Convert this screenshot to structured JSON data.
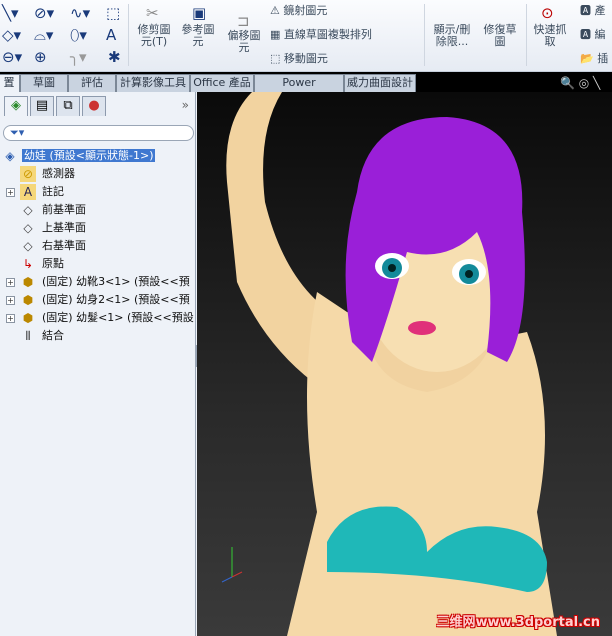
{
  "toolbar": {
    "trim": "修剪圖元(T)",
    "convert": "參考圖元",
    "offset": "偏移圖元",
    "mirror": "鏡射圖元",
    "linear_pattern": "直線草圖複製排列",
    "move": "移動圖元",
    "display_delete": "顯示/刪除限...",
    "repair": "修復草圖",
    "quick_snap": "快速抓取",
    "right1": "產",
    "right2": "編",
    "right3": "插"
  },
  "tabs": [
    "置",
    "草圖",
    "評估",
    "計算影像工具",
    "Office 產品",
    "Power Surfacing",
    "威力曲面設計"
  ],
  "tree": {
    "root": "幼娃 (預設<顯示狀態-1>)",
    "items": [
      {
        "label": "感測器",
        "icon": "sensor-folder-icon",
        "expand": false
      },
      {
        "label": "註記",
        "icon": "annotation-folder-icon",
        "expand": true
      },
      {
        "label": "前基準面",
        "icon": "plane-icon",
        "expand": false
      },
      {
        "label": "上基準面",
        "icon": "plane-icon",
        "expand": false
      },
      {
        "label": "右基準面",
        "icon": "plane-icon",
        "expand": false
      },
      {
        "label": "原點",
        "icon": "origin-icon",
        "expand": false
      },
      {
        "label": "(固定) 幼靴3<1> (預設<<預",
        "icon": "part-icon",
        "expand": true
      },
      {
        "label": "(固定) 幼身2<1> (預設<<預",
        "icon": "part-icon",
        "expand": true
      },
      {
        "label": "(固定) 幼髮<1> (預設<<預設",
        "icon": "part-icon",
        "expand": true
      },
      {
        "label": "結合",
        "icon": "mates-icon",
        "expand": false
      }
    ]
  },
  "watermark": "三维网www.3dportal.cn",
  "colors": {
    "hair": "#9a1fd8",
    "skin": "#f5d9a8",
    "bikini": "#1fb8b8",
    "selection": "#3f78d0"
  }
}
